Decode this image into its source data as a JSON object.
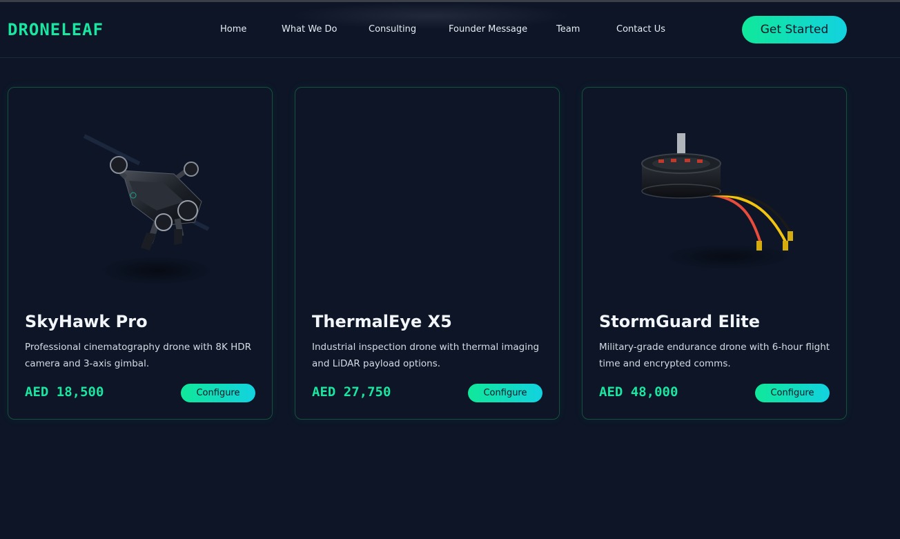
{
  "brand": {
    "name": "DRONELEAF"
  },
  "nav": {
    "items": [
      {
        "label": "Home"
      },
      {
        "label": "What We Do"
      },
      {
        "label": "Consulting"
      },
      {
        "label": "Founder Message"
      },
      {
        "label": "Team"
      },
      {
        "label": "Contact Us"
      }
    ],
    "cta_label": "Get Started"
  },
  "products": [
    {
      "title": "SkyHawk Pro",
      "description": "Professional cinematography drone with 8K HDR camera and 3-axis gimbal.",
      "price": "AED 18,500",
      "button_label": "Configure",
      "image": "drone-image"
    },
    {
      "title": "ThermalEye X5",
      "description": "Industrial inspection drone with thermal imaging and LiDAR payload options.",
      "price": "AED 27,750",
      "button_label": "Configure",
      "image": ""
    },
    {
      "title": "StormGuard Elite",
      "description": "Military-grade endurance drone with 6-hour flight time and encrypted comms.",
      "price": "AED 48,000",
      "button_label": "Configure",
      "image": "motor-image"
    }
  ],
  "colors": {
    "background": "#0d1526",
    "accent": "#19e6a0",
    "accent_gradient_end": "#12d2e0",
    "card_border": "#17503f"
  }
}
